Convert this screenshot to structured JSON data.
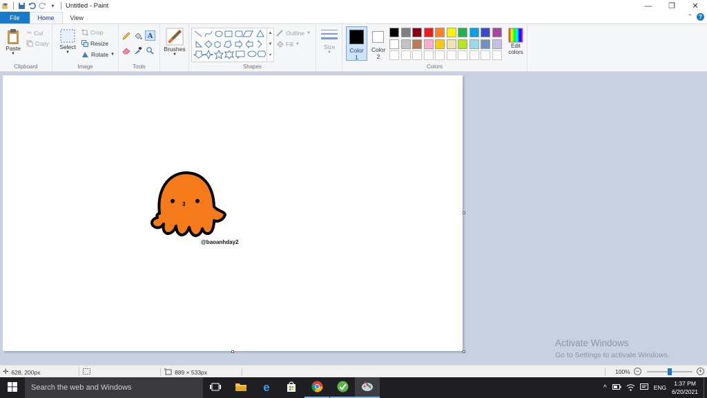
{
  "window": {
    "title": "Untitled - Paint",
    "minimize": "—",
    "restore": "❐",
    "close": "✕"
  },
  "tabs": {
    "file": "File",
    "home": "Home",
    "view": "View"
  },
  "ribbon": {
    "clipboard": {
      "paste": "Paste",
      "cut": "Cut",
      "copy": "Copy",
      "label": "Clipboard"
    },
    "image": {
      "select": "Select",
      "crop": "Crop",
      "resize": "Resize",
      "rotate": "Rotate",
      "label": "Image"
    },
    "tools": {
      "label": "Tools"
    },
    "brushes": {
      "label": "Brushes"
    },
    "shapes": {
      "outline": "Outline",
      "fill": "Fill",
      "label": "Shapes"
    },
    "size": {
      "label": "Size"
    },
    "colors": {
      "color1": "Color 1",
      "color1_line1": "Color",
      "color1_line2": "1",
      "color2_line1": "Color",
      "color2_line2": "2",
      "edit_line1": "Edit",
      "edit_line2": "colors",
      "label": "Colors",
      "color1_value": "#000000",
      "color2_value": "#ffffff",
      "palette_row1": [
        "#000000",
        "#7f7f7f",
        "#880015",
        "#ed1c24",
        "#ff7f27",
        "#fff200",
        "#22b14c",
        "#00a2e8",
        "#3f48cc",
        "#a349a4"
      ],
      "palette_row2": [
        "#ffffff",
        "#c3c3c3",
        "#b97a57",
        "#ffaec9",
        "#ffc90e",
        "#efe4b0",
        "#b5e61d",
        "#99d9ea",
        "#7092be",
        "#c8bfe7"
      ]
    }
  },
  "canvas": {
    "artwork_credit": "@baoanhday2",
    "creature_color": "#f47a1a"
  },
  "watermark": {
    "line1": "Activate Windows",
    "line2": "Go to Settings to activate Windows."
  },
  "status": {
    "cursor_pos": "628, 200px",
    "canvas_size": "889 × 533px",
    "zoom": "100%",
    "zoom_level": 0.5
  },
  "taskbar": {
    "search_placeholder": "Search the web and Windows",
    "language": "ENG",
    "time": "1:37 PM",
    "date": "6/20/2021"
  }
}
